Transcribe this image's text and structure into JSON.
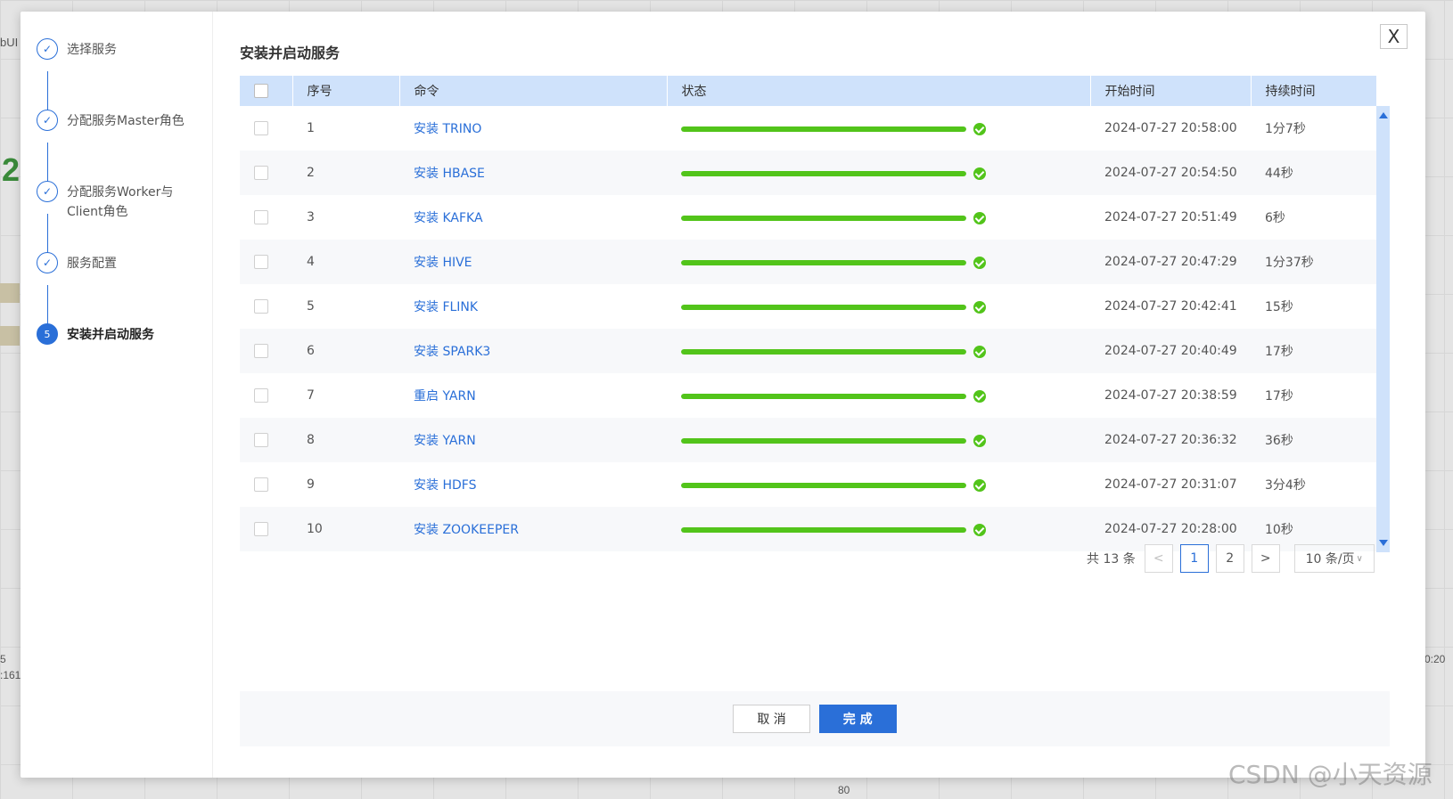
{
  "background": {
    "fragment_top_left": "bUI",
    "fragment_big": "2",
    "fragment_bottom_left_1": "5",
    "fragment_bottom_left_2": ":161",
    "fragment_bottom_right": "0:20",
    "fragment_bottom_center": "80"
  },
  "steps": [
    {
      "number": "1",
      "label": "选择服务",
      "state": "done"
    },
    {
      "number": "2",
      "label": "分配服务Master角色",
      "state": "done"
    },
    {
      "number": "3",
      "label": "分配服务Worker与Client角色",
      "state": "done"
    },
    {
      "number": "4",
      "label": "服务配置",
      "state": "done"
    },
    {
      "number": "5",
      "label": "安装并启动服务",
      "state": "active"
    }
  ],
  "close_label": "X",
  "title": "安装并启动服务",
  "table": {
    "headers": {
      "index": "序号",
      "command": "命令",
      "status": "状态",
      "start_time": "开始时间",
      "duration": "持续时间"
    },
    "rows": [
      {
        "index": "1",
        "command": "安装 TRINO",
        "progress": 100,
        "start_time": "2024-07-27 20:58:00",
        "duration": "1分7秒"
      },
      {
        "index": "2",
        "command": "安装 HBASE",
        "progress": 100,
        "start_time": "2024-07-27 20:54:50",
        "duration": "44秒"
      },
      {
        "index": "3",
        "command": "安装 KAFKA",
        "progress": 100,
        "start_time": "2024-07-27 20:51:49",
        "duration": "6秒"
      },
      {
        "index": "4",
        "command": "安装 HIVE",
        "progress": 100,
        "start_time": "2024-07-27 20:47:29",
        "duration": "1分37秒"
      },
      {
        "index": "5",
        "command": "安装 FLINK",
        "progress": 100,
        "start_time": "2024-07-27 20:42:41",
        "duration": "15秒"
      },
      {
        "index": "6",
        "command": "安装 SPARK3",
        "progress": 100,
        "start_time": "2024-07-27 20:40:49",
        "duration": "17秒"
      },
      {
        "index": "7",
        "command": "重启 YARN",
        "progress": 100,
        "start_time": "2024-07-27 20:38:59",
        "duration": "17秒"
      },
      {
        "index": "8",
        "command": "安装 YARN",
        "progress": 100,
        "start_time": "2024-07-27 20:36:32",
        "duration": "36秒"
      },
      {
        "index": "9",
        "command": "安装 HDFS",
        "progress": 100,
        "start_time": "2024-07-27 20:31:07",
        "duration": "3分4秒"
      },
      {
        "index": "10",
        "command": "安装 ZOOKEEPER",
        "progress": 100,
        "start_time": "2024-07-27 20:28:00",
        "duration": "10秒"
      }
    ]
  },
  "pagination": {
    "total": "共 13 条",
    "prev": "<",
    "pages": [
      "1",
      "2"
    ],
    "current": "1",
    "next": ">",
    "page_size": "10 条/页"
  },
  "footer": {
    "cancel": "取 消",
    "finish": "完 成"
  },
  "watermark": "CSDN @小天资源",
  "colors": {
    "accent": "#2a6fd8",
    "success": "#52c41a",
    "header_bg": "#cfe2fb"
  }
}
